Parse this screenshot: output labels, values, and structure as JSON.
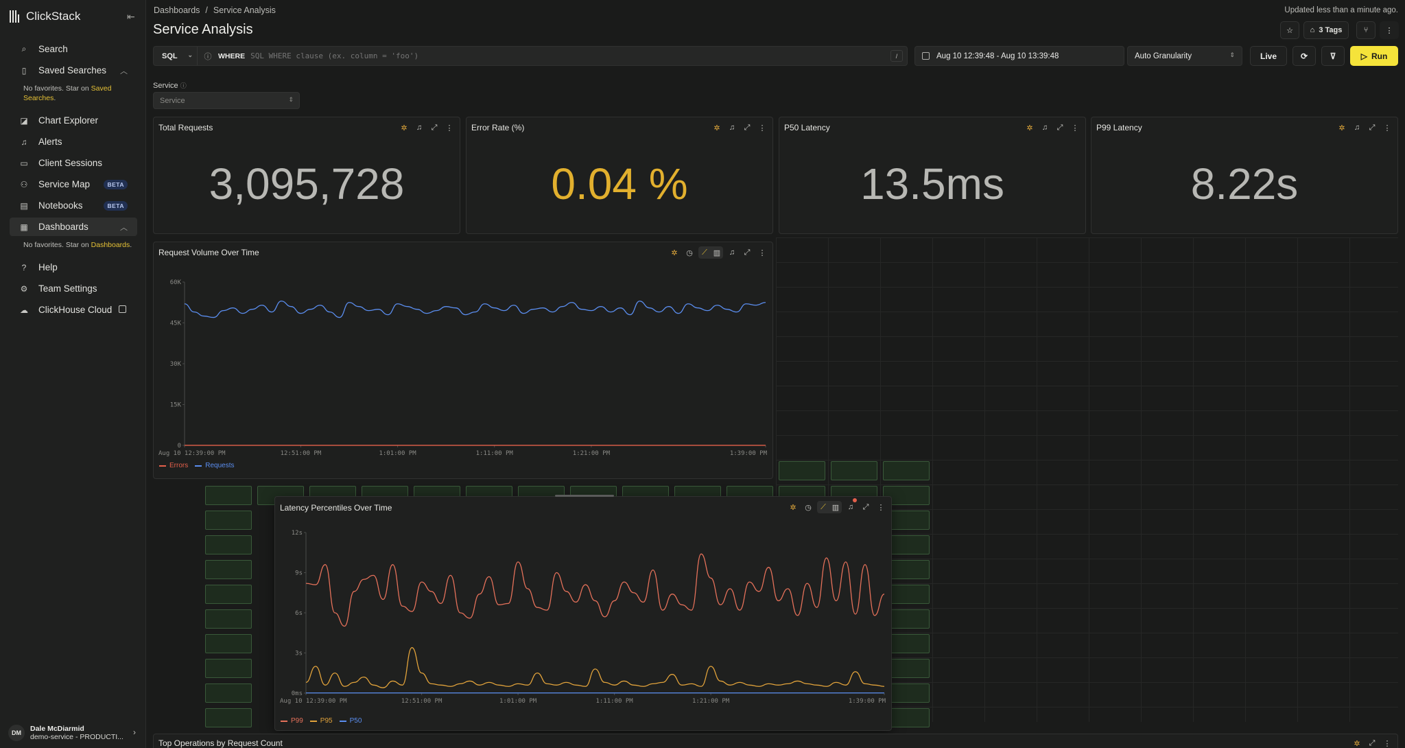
{
  "app": {
    "name": "ClickStack"
  },
  "sidebar": {
    "items": [
      {
        "label": "Search",
        "icon": "search-icon"
      },
      {
        "label": "Saved Searches",
        "icon": "bookmark-icon"
      },
      {
        "label": "Chart Explorer",
        "icon": "chart-icon"
      },
      {
        "label": "Alerts",
        "icon": "bell-icon"
      },
      {
        "label": "Client Sessions",
        "icon": "laptop-icon"
      },
      {
        "label": "Service Map",
        "icon": "service-map-icon",
        "badge": "BETA"
      },
      {
        "label": "Notebooks",
        "icon": "notebook-icon",
        "badge": "BETA"
      },
      {
        "label": "Dashboards",
        "icon": "dashboard-icon"
      },
      {
        "label": "Help",
        "icon": "help-icon"
      },
      {
        "label": "Team Settings",
        "icon": "gear-icon"
      },
      {
        "label": "ClickHouse Cloud",
        "icon": "cloud-icon"
      }
    ],
    "saved_note_prefix": "No favorites. Star on ",
    "saved_note_link": "Saved Searches",
    "dash_note_prefix": "No favorites. Star on ",
    "dash_note_link": "Dashboards",
    "user": {
      "initials": "DM",
      "name": "Dale McDiarmid",
      "sub": "demo-service - PRODUCTI..."
    }
  },
  "header": {
    "breadcrumb": [
      "Dashboards",
      "Service Analysis"
    ],
    "updated": "Updated less than a minute ago.",
    "title": "Service Analysis",
    "tags_label": "3 Tags"
  },
  "query": {
    "language": "SQL",
    "where": "WHERE",
    "placeholder": "SQL WHERE clause (ex. column = 'foo')",
    "shortcut": "/",
    "time_range": "Aug 10 12:39:48 - Aug 10 13:39:48",
    "granularity": "Auto Granularity",
    "live": "Live",
    "run": "Run"
  },
  "filter": {
    "label": "Service",
    "placeholder": "Service"
  },
  "tiles": {
    "total_requests": {
      "title": "Total Requests",
      "value": "3,095,728"
    },
    "error_rate": {
      "title": "Error Rate (%)",
      "value": "0.04 %"
    },
    "p50": {
      "title": "P50 Latency",
      "value": "13.5ms"
    },
    "p99": {
      "title": "P99 Latency",
      "value": "8.22s"
    },
    "request_volume": {
      "title": "Request Volume Over Time"
    },
    "latency": {
      "title": "Latency Percentiles Over Time"
    },
    "top_ops": {
      "title": "Top Operations by Request Count"
    }
  },
  "chart_data": [
    {
      "type": "line",
      "title": "Request Volume Over Time",
      "yticks": [
        "60K",
        "45K",
        "30K",
        "15K",
        "0"
      ],
      "ylim": [
        0,
        60000
      ],
      "xticks": [
        "Aug 10 12:39:00 PM",
        "12:51:00 PM",
        "1:01:00 PM",
        "1:11:00 PM",
        "1:21:00 PM",
        "1:39:00 PM"
      ],
      "xtick_minutes": [
        0,
        12,
        22,
        32,
        42,
        60
      ],
      "colors": {
        "Errors": "#e5604b",
        "Requests": "#5b8ef0"
      },
      "series": [
        {
          "name": "Requests",
          "values": [
            52000,
            49000,
            47500,
            47000,
            49500,
            50500,
            48500,
            50000,
            51500,
            49000,
            53000,
            51000,
            48500,
            50000,
            51500,
            49000,
            47000,
            52500,
            51000,
            49500,
            50000,
            48000,
            52000,
            51000,
            50000,
            48500,
            49500,
            51000,
            50500,
            48000,
            49000,
            52000,
            50500,
            49500,
            51500,
            48500,
            50000,
            50500,
            49000,
            51000,
            52500,
            50000,
            49500,
            51000,
            49000,
            50500,
            48000,
            53000,
            50500,
            49000,
            51000,
            48500,
            52000,
            50500,
            49500,
            51500,
            50000,
            49000,
            52000,
            51500,
            52500
          ]
        },
        {
          "name": "Errors",
          "values": [
            15,
            20,
            18,
            22,
            16,
            19,
            21,
            17,
            18,
            20,
            16,
            22,
            19,
            18,
            21,
            17,
            20,
            18,
            19,
            22,
            16,
            20,
            18,
            21,
            17,
            19,
            20,
            18,
            22,
            16,
            19,
            21,
            17,
            18,
            20,
            16,
            22,
            19,
            18,
            21,
            17,
            20,
            18,
            19,
            22,
            16,
            20,
            18,
            21,
            17,
            19,
            20,
            18,
            22,
            16,
            19,
            21,
            17,
            18,
            20,
            18
          ]
        }
      ]
    },
    {
      "type": "line",
      "title": "Latency Percentiles Over Time",
      "yticks": [
        "12s",
        "9s",
        "6s",
        "3s",
        "0ms"
      ],
      "ylim": [
        0,
        12000
      ],
      "xticks": [
        "Aug 10 12:39:00 PM",
        "12:51:00 PM",
        "1:01:00 PM",
        "1:11:00 PM",
        "1:21:00 PM",
        "1:39:00 PM"
      ],
      "xtick_minutes": [
        0,
        12,
        22,
        32,
        42,
        60
      ],
      "colors": {
        "P99": "#e5715a",
        "P95": "#e2a33b",
        "P50": "#5b8ef0"
      },
      "series": [
        {
          "name": "P99",
          "values": [
            8200,
            8100,
            9600,
            6000,
            5000,
            7600,
            8500,
            8800,
            7000,
            9600,
            6500,
            6100,
            8300,
            7600,
            6700,
            8800,
            6000,
            5600,
            7400,
            8700,
            6600,
            6700,
            9800,
            7800,
            6400,
            6200,
            9000,
            7600,
            6800,
            8100,
            6900,
            5700,
            6900,
            8300,
            7500,
            6800,
            9200,
            6200,
            7400,
            6600,
            6200,
            10400,
            8600,
            6600,
            7800,
            6200,
            8300,
            7600,
            9400,
            6900,
            7800,
            5800,
            8200,
            6400,
            10100,
            6900,
            9800,
            5900,
            9600,
            5800,
            7400
          ]
        },
        {
          "name": "P95",
          "values": [
            800,
            2000,
            600,
            1500,
            500,
            800,
            1200,
            600,
            400,
            900,
            600,
            3400,
            1500,
            700,
            600,
            500,
            700,
            900,
            600,
            800,
            600,
            500,
            700,
            600,
            1500,
            700,
            600,
            800,
            600,
            500,
            1800,
            800,
            600,
            900,
            600,
            500,
            700,
            800,
            1400,
            600,
            700,
            500,
            2000,
            900,
            600,
            800,
            600,
            500,
            700,
            600,
            700,
            900,
            700,
            600,
            500,
            800,
            600,
            1600,
            700,
            600,
            500
          ]
        },
        {
          "name": "P50",
          "values": [
            14,
            13,
            14,
            13,
            14,
            13,
            13,
            14,
            14,
            13,
            14,
            13,
            14,
            13,
            14,
            13,
            13,
            14,
            14,
            13,
            14,
            13,
            14,
            13,
            14,
            13,
            13,
            14,
            14,
            13,
            14,
            13,
            14,
            13,
            14,
            13,
            13,
            14,
            14,
            13,
            14,
            13,
            14,
            13,
            14,
            13,
            13,
            14,
            14,
            13,
            14,
            13,
            14,
            13,
            14,
            13,
            13,
            14,
            14,
            13,
            14
          ]
        }
      ]
    }
  ]
}
